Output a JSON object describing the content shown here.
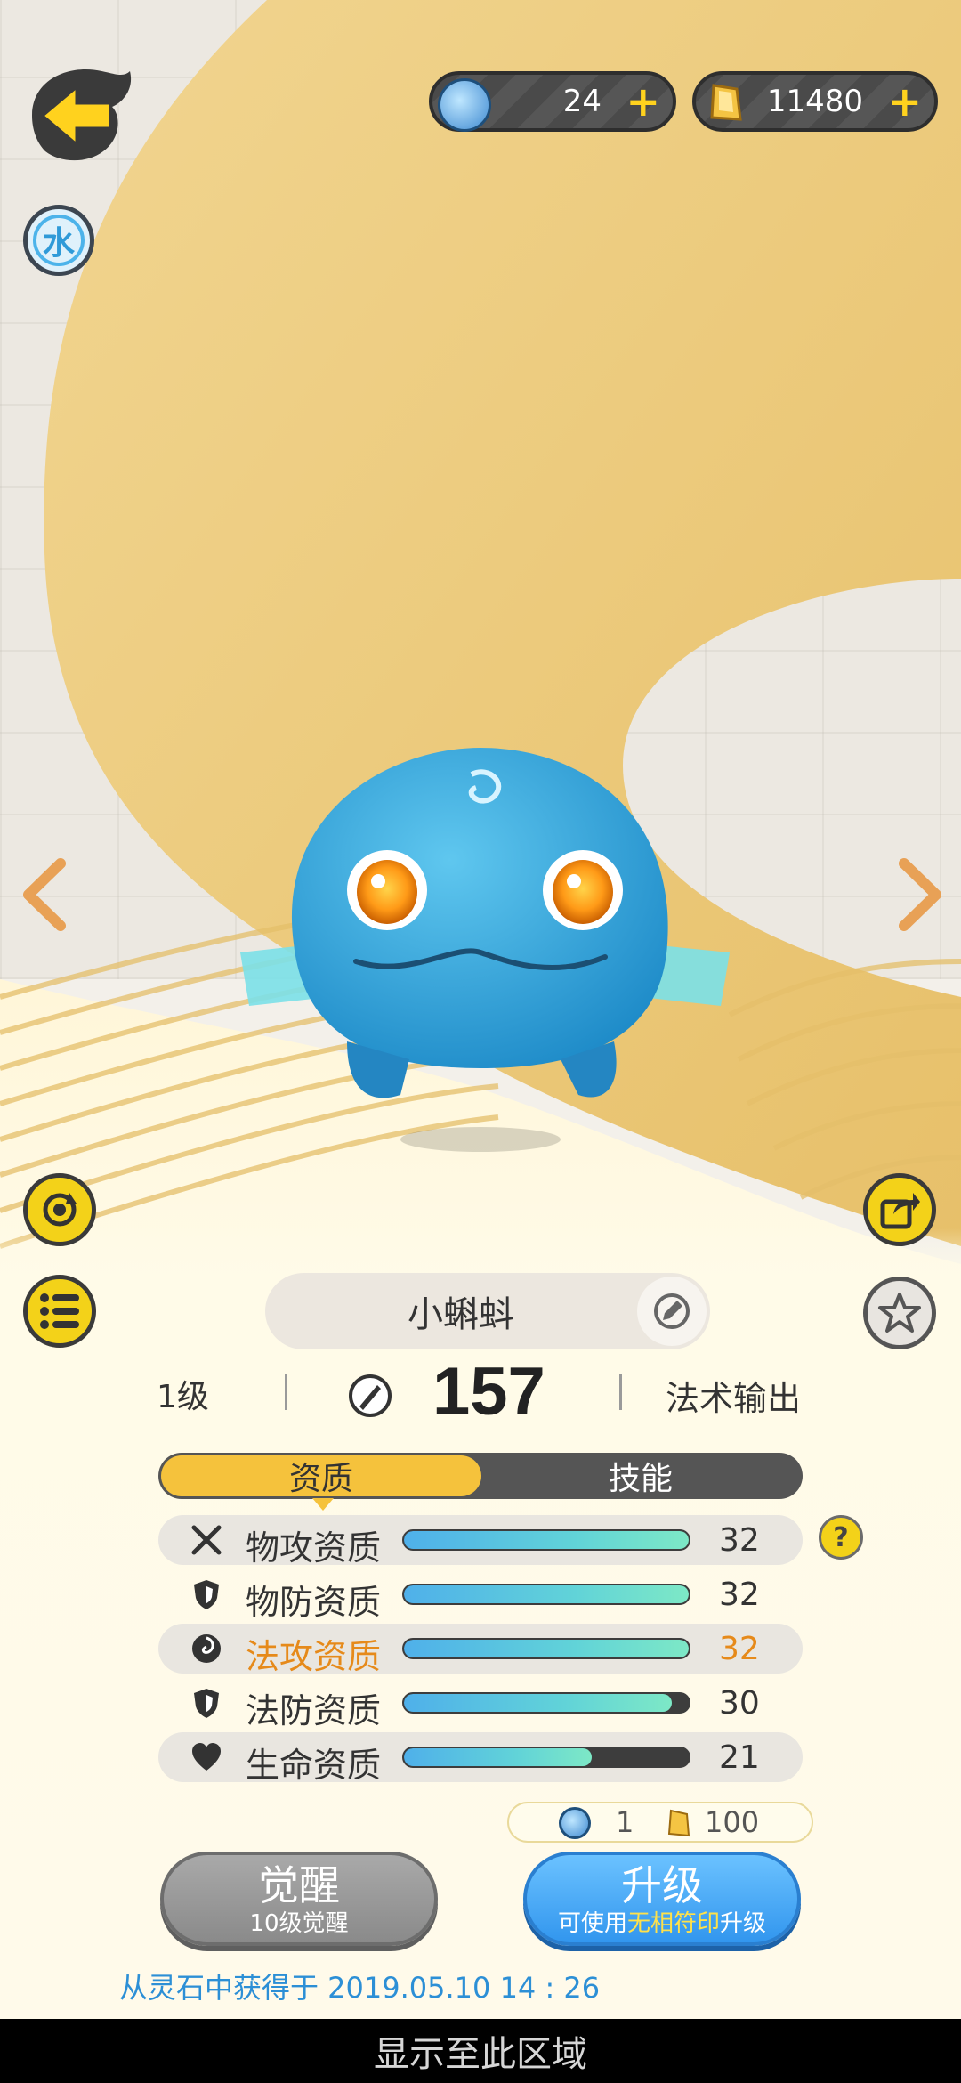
{
  "header": {
    "element_char": "水",
    "currency_gems": "24",
    "currency_coins": "11480",
    "plus": "+"
  },
  "pet": {
    "name": "小蝌蚪",
    "level": "1级",
    "power": "157",
    "role": "法术输出"
  },
  "tabs": [
    {
      "label": "资质",
      "active": true
    },
    {
      "label": "技能",
      "active": false
    }
  ],
  "attributes": [
    {
      "label": "物攻资质",
      "value": "32",
      "fill": 1.0,
      "icon": "swords-icon",
      "highlight": false
    },
    {
      "label": "物防资质",
      "value": "32",
      "fill": 1.0,
      "icon": "shield-icon",
      "highlight": false
    },
    {
      "label": "法攻资质",
      "value": "32",
      "fill": 1.0,
      "icon": "swirl-icon",
      "highlight": true
    },
    {
      "label": "法防资质",
      "value": "30",
      "fill": 0.94,
      "icon": "shield-icon",
      "highlight": false
    },
    {
      "label": "生命资质",
      "value": "21",
      "fill": 0.66,
      "icon": "heart-icon",
      "highlight": false
    }
  ],
  "cost": {
    "gem": "1",
    "coin": "100"
  },
  "buttons": {
    "awaken_title": "觉醒",
    "awaken_sub": "10级觉醒",
    "upgrade_title": "升级",
    "upgrade_sub_pre": "可使用",
    "upgrade_sub_hl": "无相符印",
    "upgrade_sub_post": "升级"
  },
  "obtain_text": "从灵石中获得于 2019.05.10   14 : 26",
  "bottom_bar": "显示至此区域",
  "colors": {
    "accent_yellow": "#f5c23c",
    "highlight_orange": "#e68a1a",
    "link_blue": "#2c8fd6",
    "upgrade_blue": "#3296ee"
  }
}
